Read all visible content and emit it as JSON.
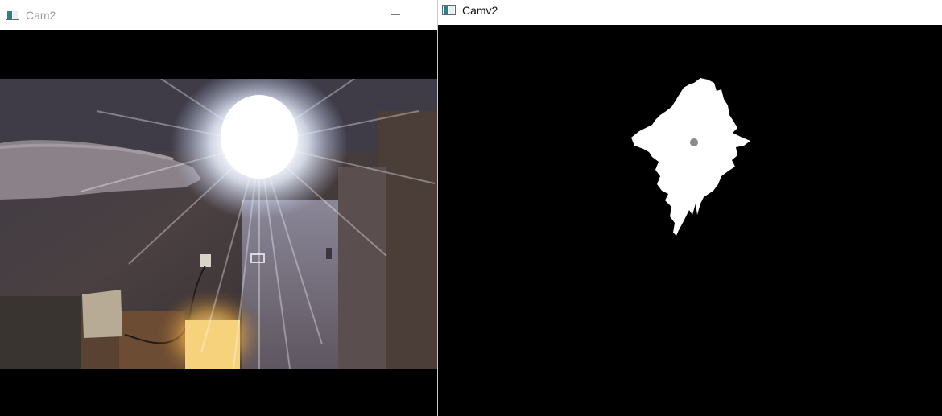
{
  "left_window": {
    "title": "Cam2",
    "icon": "opencv-window-icon",
    "controls": {
      "minimize": "minimize-icon"
    }
  },
  "right_window": {
    "title": "Camv2",
    "icon": "opencv-window-icon"
  }
}
